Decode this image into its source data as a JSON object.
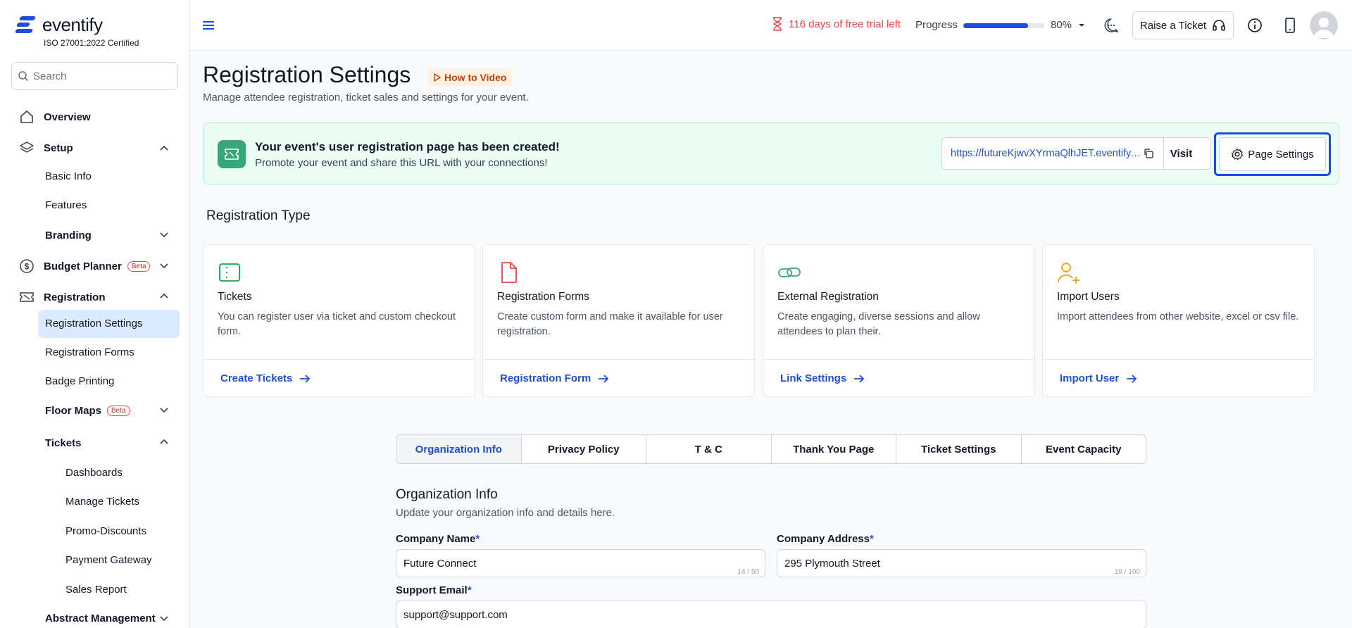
{
  "brand": {
    "name": "eventify",
    "certification": "ISO 27001:2022 Certified"
  },
  "search": {
    "placeholder": "Search"
  },
  "sidebar": {
    "overview": "Overview",
    "setup": "Setup",
    "basic_info": "Basic Info",
    "features": "Features",
    "branding": "Branding",
    "budget_planner": "Budget Planner",
    "beta": "Beta",
    "registration": "Registration",
    "registration_settings": "Registration Settings",
    "registration_forms": "Registration Forms",
    "badge_printing": "Badge Printing",
    "floor_maps": "Floor Maps",
    "tickets": "Tickets",
    "dashboards": "Dashboards",
    "manage_tickets": "Manage Tickets",
    "promo_discounts": "Promo-Discounts",
    "payment_gateway": "Payment Gateway",
    "sales_report": "Sales Report",
    "abstract_management": "Abstract Management"
  },
  "header": {
    "trial_text": "116 days of free trial left",
    "progress_label": "Progress",
    "progress_value": "80%",
    "progress_fraction": 0.8,
    "raise_ticket": "Raise a Ticket"
  },
  "page": {
    "title": "Registration Settings",
    "how_to_video": "How to Video",
    "subtitle": "Manage attendee registration, ticket sales and settings for your event."
  },
  "banner": {
    "title": "Your event's user registration page has been created!",
    "subtitle": "Promote your event and share this URL with your connections!",
    "url": "https://futureKjwvXYrmaQlhJET.eventify.io",
    "visit": "Visit",
    "page_settings": "Page Settings"
  },
  "registration_type": {
    "title": "Registration Type",
    "cards": [
      {
        "title": "Tickets",
        "desc": "You can register user via ticket and custom checkout form.",
        "link": "Create Tickets",
        "icon": "ticket-icon",
        "color": "#16a34a"
      },
      {
        "title": "Registration Forms",
        "desc": "Create custom form and make it available for user registration.",
        "link": "Registration Form",
        "icon": "document-icon",
        "color": "#ef4444"
      },
      {
        "title": "External Registration",
        "desc": "Create engaging, diverse sessions and allow attendees to plan their.",
        "link": "Link Settings",
        "icon": "link-icon",
        "color": "#34a878"
      },
      {
        "title": "Import Users",
        "desc": "Import attendees from other website, excel or csv file.",
        "link": "Import User",
        "icon": "user-plus-icon",
        "color": "#f59e0b"
      }
    ]
  },
  "tabs": [
    "Organization Info",
    "Privacy Policy",
    "T & C",
    "Thank You Page",
    "Ticket Settings",
    "Event Capacity"
  ],
  "org_info": {
    "title": "Organization Info",
    "subtitle": "Update your organization info and details here.",
    "company_name_label": "Company Name",
    "company_name": "Future Connect",
    "company_name_count": "14 / 50",
    "company_address_label": "Company Address",
    "company_address": "295 Plymouth Street",
    "company_address_count": "19 / 100",
    "support_email_label": "Support Email",
    "support_email": "support@support.com",
    "required_mark": "*"
  },
  "colors": {
    "accent": "#1d4ed8",
    "danger": "#ef4444",
    "success": "#34a878"
  }
}
